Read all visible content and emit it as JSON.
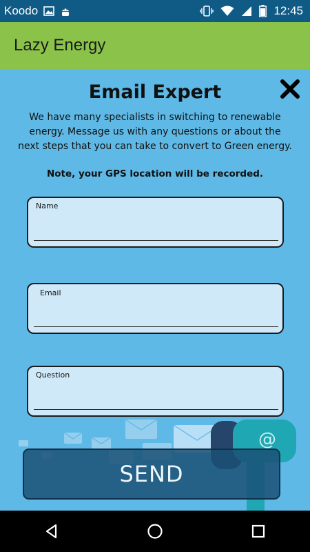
{
  "status_bar": {
    "carrier": "Koodo",
    "time": "12:45",
    "icons": [
      "image-icon",
      "android-icon",
      "vibrate-icon",
      "wifi-icon",
      "signal-icon",
      "battery-icon"
    ]
  },
  "app_bar": {
    "title": "Lazy Energy",
    "color": "#8bc34a"
  },
  "dialog": {
    "title": "Email Expert",
    "close_icon": "close-icon",
    "intro": "We have many specialists in switching to renewable energy. Message us with any questions or about the next steps that you can take to convert to Green energy.",
    "note": "Note, your GPS location will be recorded.",
    "fields": {
      "name": {
        "label": "Name",
        "value": ""
      },
      "email": {
        "label": "Email",
        "value": ""
      },
      "question": {
        "label": "Question",
        "value": ""
      }
    },
    "send_label": "SEND",
    "background_color": "#5fb9e6",
    "decoration": "envelopes-and-mailbox-illustration"
  },
  "nav_bar": {
    "icons": [
      "back-icon",
      "home-icon",
      "recents-icon"
    ]
  }
}
